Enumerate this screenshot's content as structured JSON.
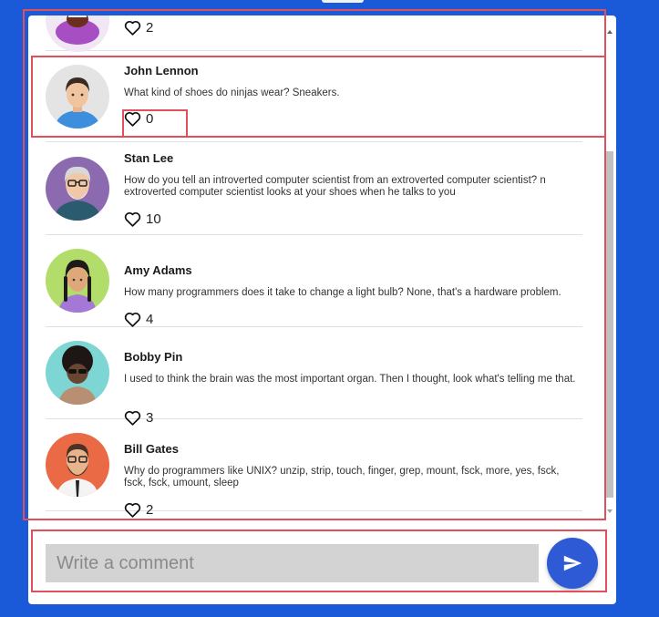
{
  "comments": [
    {
      "name": "",
      "text": "",
      "likes": "2",
      "avatar": "avatar-purple-icon"
    },
    {
      "name": "John Lennon",
      "text": "What kind of shoes do ninjas wear? Sneakers.",
      "likes": "0",
      "avatar": "avatar-john-icon"
    },
    {
      "name": "Stan Lee",
      "text": "How do you tell an introverted computer scientist from an extroverted computer scientist? n extroverted computer scientist looks at your shoes when he talks to you",
      "likes": "10",
      "avatar": "avatar-stan-icon"
    },
    {
      "name": "Amy Adams",
      "text": "How many programmers does it take to change a light bulb? None, that's a hardware problem.",
      "likes": "4",
      "avatar": "avatar-amy-icon"
    },
    {
      "name": "Bobby Pin",
      "text": "I used to think the brain was the most important organ. Then I thought, look what's telling me that.",
      "likes": "3",
      "avatar": "avatar-bobby-icon"
    },
    {
      "name": "Bill Gates",
      "text": "Why do programmers like UNIX? unzip, strip, touch, finger, grep, mount, fsck, more, yes, fsck, fsck, fsck, umount, sleep",
      "likes": "2",
      "avatar": "avatar-bill-icon"
    }
  ],
  "composer": {
    "placeholder": "Write a comment",
    "value": ""
  },
  "icons": {
    "like": "heart-outline-icon",
    "send": "send-icon"
  },
  "colors": {
    "background": "#1a5ad8",
    "accent": "#2e5ad6",
    "highlight": "#e0505a",
    "input": "#d3d3d3"
  }
}
